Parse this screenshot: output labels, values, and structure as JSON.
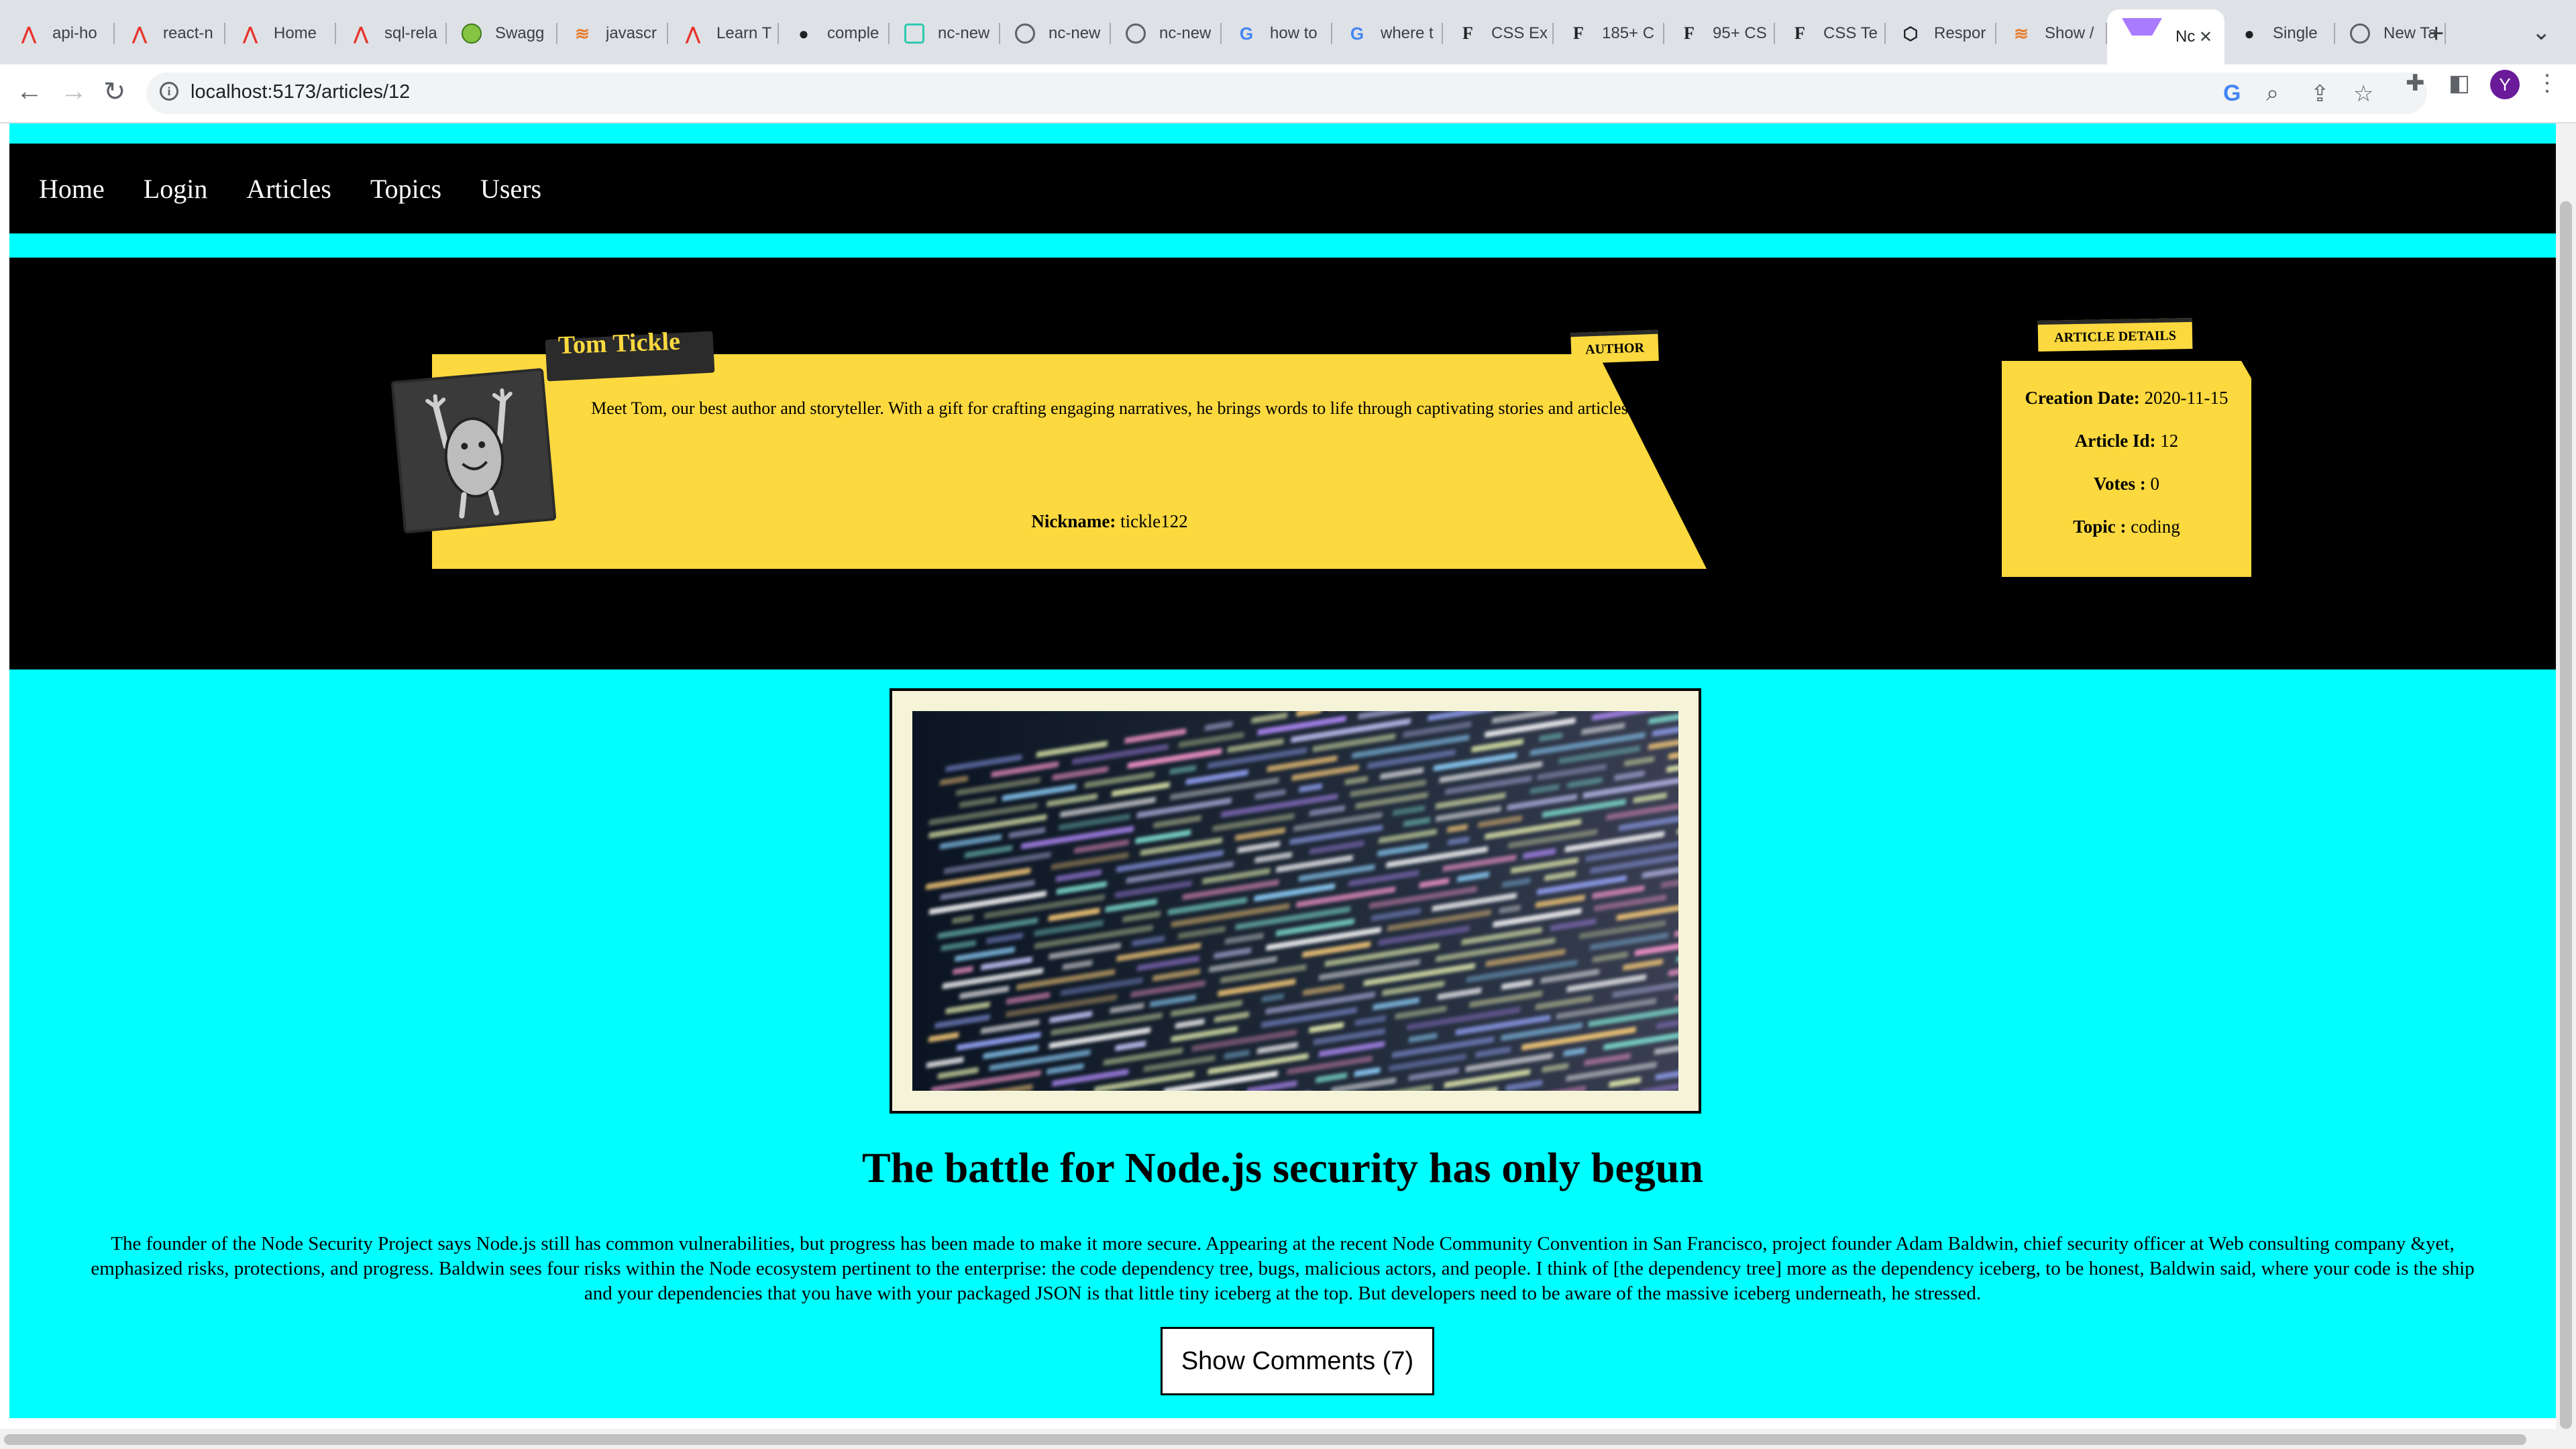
{
  "browser": {
    "tabs": [
      {
        "title": "api-ho",
        "icon": "angular-icon"
      },
      {
        "title": "react-n",
        "icon": "angular-icon"
      },
      {
        "title": "Home",
        "icon": "angular-icon"
      },
      {
        "title": "sql-rela",
        "icon": "angular-icon"
      },
      {
        "title": "Swagg",
        "icon": "swagger-icon"
      },
      {
        "title": "javascr",
        "icon": "stackoverflow-icon"
      },
      {
        "title": "Learn T",
        "icon": "angular-icon"
      },
      {
        "title": "comple",
        "icon": "github-icon"
      },
      {
        "title": "nc-new",
        "icon": "codesandbox-icon"
      },
      {
        "title": "nc-new",
        "icon": "globe-icon"
      },
      {
        "title": "nc-new",
        "icon": "globe-icon"
      },
      {
        "title": "how to",
        "icon": "google-icon"
      },
      {
        "title": "where t",
        "icon": "google-icon"
      },
      {
        "title": "CSS Ex",
        "icon": "freefrontend-icon"
      },
      {
        "title": "185+ C",
        "icon": "freefrontend-icon"
      },
      {
        "title": "95+ CS",
        "icon": "freefrontend-icon"
      },
      {
        "title": "CSS Te",
        "icon": "freefrontend-icon"
      },
      {
        "title": "Respor",
        "icon": "codepen-icon"
      },
      {
        "title": "Show /",
        "icon": "stackoverflow-icon"
      },
      {
        "title": "Nc",
        "icon": "vite-icon",
        "active": true
      },
      {
        "title": "Single",
        "icon": "github-icon"
      },
      {
        "title": "New Ta",
        "icon": "chrome-icon"
      }
    ],
    "url": "localhost:5173/articles/12",
    "profile_initial": "Y"
  },
  "nav": {
    "links": [
      "Home",
      "Login",
      "Articles",
      "Topics",
      "Users"
    ]
  },
  "author": {
    "name": "Tom Tickle",
    "badge": "AUTHOR",
    "bio": "Meet Tom, our best author and storyteller. With a gift for crafting engaging narratives, he brings words to life through captivating stories and articles",
    "nickname_label": "Nickname:",
    "nickname": "tickle122"
  },
  "details": {
    "badge": "ARTICLE DETAILS",
    "creation_label": "Creation Date:",
    "creation_date": "2020-11-15",
    "id_label": "Article Id:",
    "id": "12",
    "votes_label": "Votes :",
    "votes": "0",
    "topic_label": "Topic :",
    "topic": "coding"
  },
  "article": {
    "title": "The battle for Node.js security has only begun",
    "body": "The founder of the Node Security Project says Node.js still has common vulnerabilities, but progress has been made to make it more secure. Appearing at the recent Node Community Convention in San Francisco, project founder Adam Baldwin, chief security officer at Web consulting company &yet, emphasized risks, protections, and progress. Baldwin sees four risks within the Node ecosystem pertinent to the enterprise: the code dependency tree, bugs, malicious actors, and people. I think of [the dependency tree] more as the dependency iceberg, to be honest, Baldwin said, where your code is the ship and your dependencies that you have with your packaged JSON is that little tiny iceberg at the top. But developers need to be aware of the massive iceberg underneath, he stressed.",
    "comments_button": "Show Comments (7)"
  },
  "colors": {
    "page_bg": "#00ffff",
    "band_bg": "#000000",
    "card_bg": "#fcd93f"
  }
}
